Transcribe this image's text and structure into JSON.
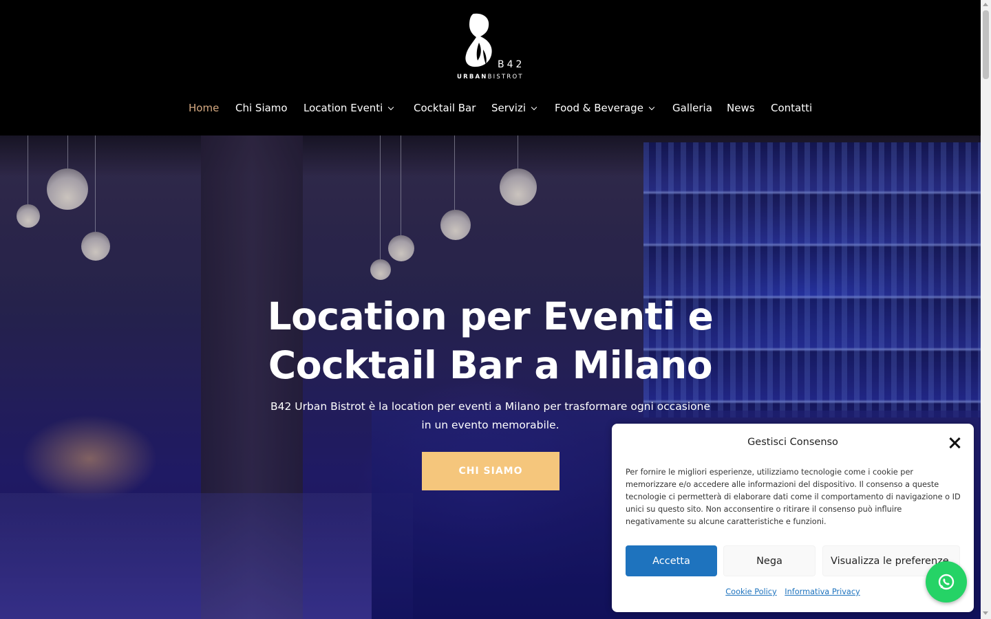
{
  "brand": {
    "logo_mark": "B42",
    "logo_sub_bold": "URBAN",
    "logo_sub": "BISTROT"
  },
  "nav": {
    "items": [
      {
        "label": "Home",
        "active": true,
        "dropdown": false
      },
      {
        "label": "Chi Siamo",
        "active": false,
        "dropdown": false
      },
      {
        "label": "Location Eventi",
        "active": false,
        "dropdown": true
      },
      {
        "label": "Cocktail Bar",
        "active": false,
        "dropdown": false
      },
      {
        "label": "Servizi",
        "active": false,
        "dropdown": true
      },
      {
        "label": "Food & Beverage",
        "active": false,
        "dropdown": true
      },
      {
        "label": "Galleria",
        "active": false,
        "dropdown": false
      },
      {
        "label": "News",
        "active": false,
        "dropdown": false
      },
      {
        "label": "Contatti",
        "active": false,
        "dropdown": false
      }
    ]
  },
  "hero": {
    "title_line1": "Location per Eventi e",
    "title_line2": "Cocktail Bar a Milano",
    "subtitle_line1": "B42 Urban Bistrot è la location per eventi a Milano per trasformare ogni occasione",
    "subtitle_line2": "in un evento memorabile.",
    "cta_label": "CHI SIAMO"
  },
  "consent": {
    "title": "Gestisci Consenso",
    "text": "Per fornire le migliori esperienze, utilizziamo tecnologie come i cookie per memorizzare e/o accedere alle informazioni del dispositivo. Il consenso a queste tecnologie ci permetterà di elaborare dati come il comportamento di navigazione o ID unici su questo sito. Non acconsentire o ritirare il consenso può influire negativamente su alcune caratteristiche e funzioni.",
    "accept_label": "Accetta",
    "deny_label": "Nega",
    "prefs_label": "Visualizza le preferenze",
    "cookie_policy_label": "Cookie Policy",
    "privacy_label": "Informativa Privacy"
  },
  "colors": {
    "header_bg": "#000000",
    "nav_active": "#d6aa82",
    "cta_bg": "#f5c67c",
    "accept_bg": "#1e73be",
    "whatsapp": "#25d366"
  },
  "icons": {
    "close": "close-icon",
    "whatsapp": "whatsapp-icon",
    "chevron": "chevron-down-icon"
  }
}
